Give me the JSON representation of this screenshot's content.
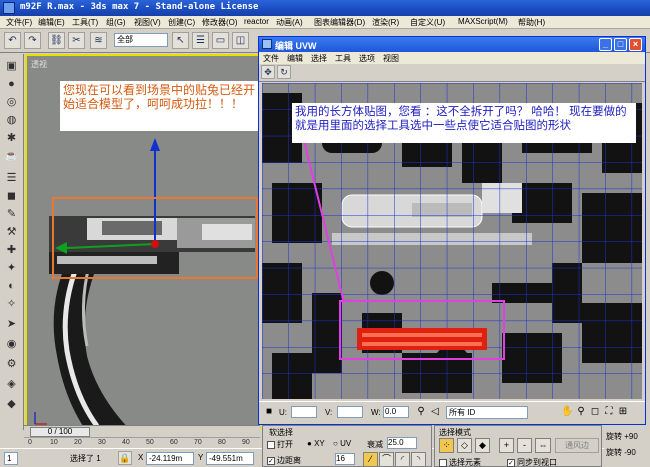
{
  "window": {
    "title": "m92F R.max - 3ds max 7 - Stand-alone License"
  },
  "menu": [
    "文件(F)",
    "编辑(E)",
    "工具(T)",
    "组(G)",
    "视图(V)",
    "创建(C)",
    "修改器(O)",
    "reactor",
    "动画(A)",
    "图表编辑器(D)",
    "渲染(R)",
    "自定义(U)",
    "MAXScript(M)",
    "帮助(H)"
  ],
  "toolbar": {
    "selection_filter": "全部"
  },
  "viewport": {
    "label": "透视",
    "note": "您现在可以看到场景中的贴兔已经开始适合模型了，呵呵成功拉！！！"
  },
  "uv_editor": {
    "title": "编辑 UVW",
    "menu": [
      "文件",
      "编辑",
      "选择",
      "工具",
      "选项",
      "视图"
    ],
    "note": "我用的长方体贴图，您看 ：这不全拆开了吗？ 哈哈！      现在要做的就是用里面的选择工具选中一些点使它适合贴图的形状",
    "u_label": "U:",
    "v_label": "V:",
    "w_label": "W:",
    "w_value": "0.0",
    "id_filter": "所有 ID"
  },
  "soft_select": {
    "group": "软选择",
    "open_label": "打开",
    "xy_label": "XY",
    "uv_label": "UV",
    "falloff_label": "衰减",
    "falloff_value": "25.0",
    "edge_distance_label": "边距离",
    "edge_distance_value": "16"
  },
  "select_mode": {
    "group": "选择模式",
    "plus": "+",
    "minus": "-",
    "loop_edge": "通风边",
    "select_element": "选择元素",
    "sync_viewport": "同步到视口"
  },
  "rotate": {
    "label1": "旋转 +90",
    "label2": "旋转 -90"
  },
  "timeline": {
    "frame": "0 / 100",
    "ticks": [
      "0",
      "10",
      "20",
      "30",
      "40",
      "50",
      "60",
      "70",
      "80",
      "90"
    ]
  },
  "status": {
    "count": "1",
    "selected": "选择了 1",
    "x_label": "X",
    "x_value": "-24.119m",
    "y_label": "Y",
    "y_value": "-49.551m"
  },
  "colors": {
    "highlight_box": "#e87830",
    "pink_box": "#e040e0",
    "uv_grid": "#2030d0",
    "viewport_frame": "#e8e000",
    "red_uv_island": "#e02010"
  }
}
